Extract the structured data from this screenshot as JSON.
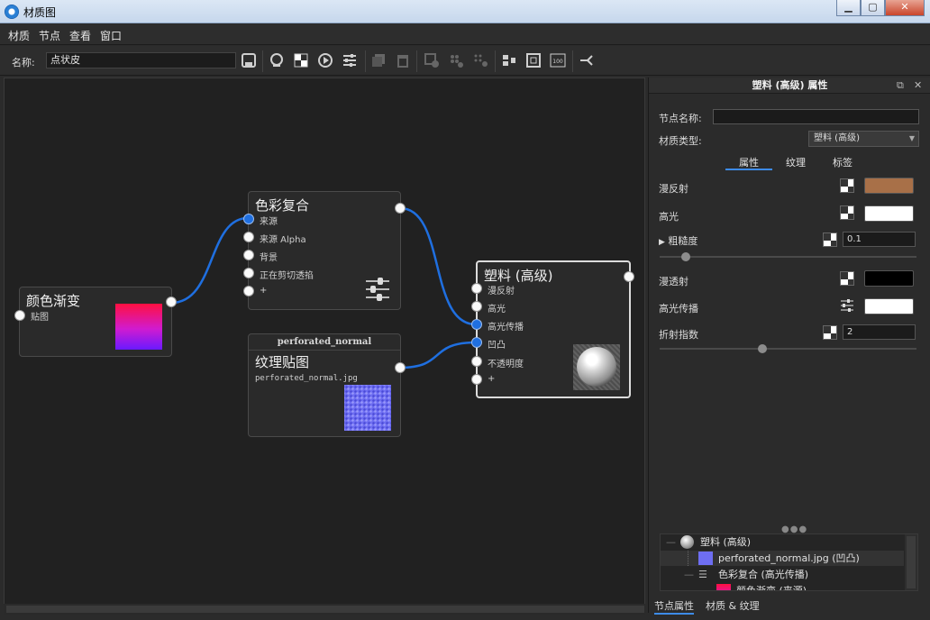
{
  "window": {
    "title": "材质图",
    "min": "▁",
    "max": "▢",
    "close": "✕"
  },
  "menu": [
    "材质",
    "节点",
    "查看",
    "窗口"
  ],
  "toolbar": {
    "name_label": "名称:",
    "name_value": "点状皮"
  },
  "nodes": {
    "gradient": {
      "title": "颜色渐变",
      "port": "贴图"
    },
    "color_composite": {
      "title": "色彩复合",
      "ports": [
        "来源",
        "来源 Alpha",
        "背景",
        "正在剪切透掐",
        "+"
      ]
    },
    "texture": {
      "header": "perforated_normal",
      "title": "纹理贴图",
      "filename": "perforated_normal.jpg"
    },
    "plastic": {
      "title": "塑料 (高级)",
      "ports": [
        "漫反射",
        "高光",
        "高光传播",
        "凹凸",
        "不透明度",
        "+"
      ]
    }
  },
  "panel": {
    "title": "塑料 (高级) 属性",
    "node_name_label": "节点名称:",
    "node_name_value": "",
    "material_type_label": "材质类型:",
    "material_type_value": "塑料 (高级)",
    "tabs": [
      "属性",
      "纹理",
      "标签"
    ],
    "props": {
      "diffuse": "漫反射",
      "specular": "高光",
      "roughness": "粗糙度",
      "roughness_value": "0.1",
      "roughness_slider": 0.1,
      "transmission": "漫透射",
      "spec_spread": "高光传播",
      "ior": "折射指数",
      "ior_value": "2",
      "ior_slider": 0.4
    },
    "colors": {
      "diffuse": "#a87048",
      "specular": "#ffffff",
      "transmission": "#000000",
      "spec_spread": "#ffffff"
    },
    "tree": [
      "塑料 (高级)",
      "perforated_normal.jpg (凹凸)",
      "色彩复合 (高光传播)",
      "颜色渐变 (来源)"
    ],
    "bottom_tabs": [
      "节点属性",
      "材质 & 纹理"
    ]
  },
  "colors": {
    "accent": "#3d8be8",
    "wire": "#1f6fe0",
    "canvas": "#212121"
  }
}
